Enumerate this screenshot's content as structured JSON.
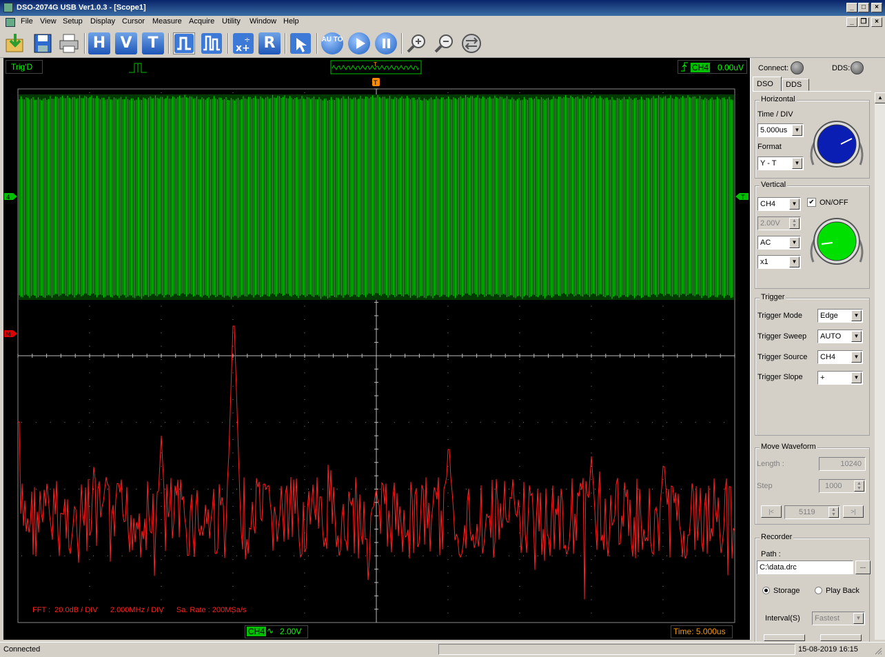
{
  "window": {
    "title": "DSO-2074G USB Ver1.0.3 - [Scope1]"
  },
  "menu": [
    "File",
    "View",
    "Setup",
    "Display",
    "Cursor",
    "Measure",
    "Acquire",
    "Utility",
    "Window",
    "Help"
  ],
  "toolbar": {
    "h": "H",
    "v": "V",
    "t": "T",
    "r": "R",
    "auto": "AU TO"
  },
  "scope": {
    "trig_status": "Trig'D",
    "trigger_channel": "CH4",
    "trigger_level": "0.00uV",
    "channel_marker": "4",
    "math_marker": "M",
    "trigger_marker": "T",
    "fft_info": "FFT :  20.0dB / DIV      2.000MHz / DIV      Sa. Rate : 200MSa/s",
    "bottom_channel": "CH4",
    "bottom_coupling": "∿",
    "bottom_volts": "2.00V",
    "bottom_time": "Time: 5.000us",
    "colors": {
      "signal": "#00c800",
      "fft": "#ff2020",
      "grid": "#8a8a8a"
    }
  },
  "panel": {
    "connect_label": "Connect:",
    "dds_label": "DDS:",
    "tabs": [
      "DSO",
      "DDS"
    ],
    "horizontal": {
      "title": "Horizontal",
      "time_div_label": "Time / DIV",
      "time_div": "5.000us",
      "format_label": "Format",
      "format": "Y - T"
    },
    "vertical": {
      "title": "Vertical",
      "channel": "CH4",
      "onoff_label": "ON/OFF",
      "volts": "2.00V",
      "coupling": "AC",
      "probe": "x1"
    },
    "trigger": {
      "title": "Trigger",
      "mode_label": "Trigger Mode",
      "mode": "Edge",
      "sweep_label": "Trigger Sweep",
      "sweep": "AUTO",
      "source_label": "Trigger Source",
      "source": "CH4",
      "slope_label": "Trigger Slope",
      "slope": "+"
    },
    "move": {
      "title": "Move Waveform",
      "length_label": "Length :",
      "length": "10240",
      "step_label": "Step",
      "step": "1000",
      "pos": "5119",
      "prev": "|<",
      "next": ">|"
    },
    "recorder": {
      "title": "Recorder",
      "path_label": "Path :",
      "path": "C:\\data.drc",
      "browse": "...",
      "storage": "Storage",
      "playback": "Play Back",
      "interval_label": "Interval(S)",
      "interval": "Fastest"
    }
  },
  "status": {
    "text": "Connected",
    "datetime": "15-08-2019  16:15"
  }
}
